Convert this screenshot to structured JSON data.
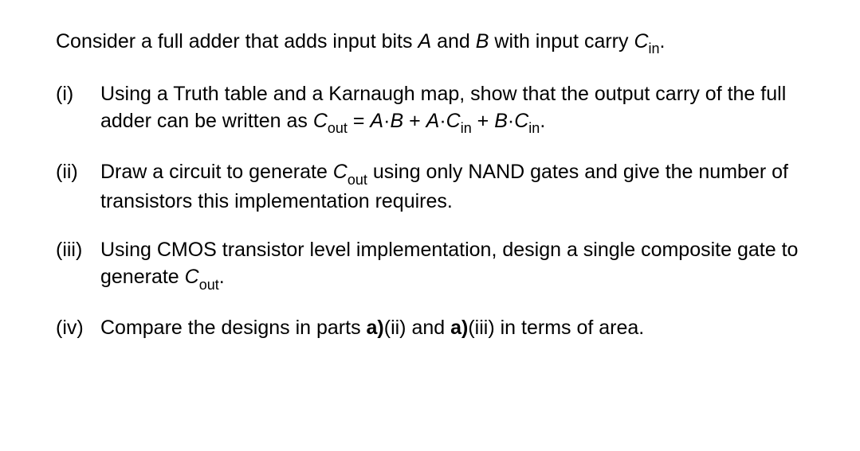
{
  "intro": {
    "pre": "Consider a full adder that adds input bits ",
    "A": "A",
    "mid1": " and ",
    "B": "B",
    "mid2": " with input carry ",
    "C": "C",
    "in": "in",
    "period": "."
  },
  "items": [
    {
      "marker": "(i)",
      "body": {
        "t1": "Using a Truth table and a Karnaugh map, show that the output carry of the full adder can be written as ",
        "C1": "C",
        "out1": "out",
        "eq1": " = ",
        "A1": "A",
        "dot1": "·",
        "B1": "B",
        "plus1": " + ",
        "A2": "A",
        "dot2": "·",
        "C2": "C",
        "in1": "in",
        "plus2": " + ",
        "B2": "B",
        "dot3": "·",
        "C3": "C",
        "in2": "in",
        "period": "."
      }
    },
    {
      "marker": "(ii)",
      "body": {
        "t1": "Draw a circuit to generate ",
        "C1": "C",
        "out1": "out",
        "t2": " using only NAND gates and give the number of transistors this implementation requires."
      }
    },
    {
      "marker": "(iii)",
      "body": {
        "t1": "Using CMOS transistor level implementation, design a single composite gate to generate ",
        "C1": "C",
        "out1": "out",
        "period": "."
      }
    },
    {
      "marker": "(iv)",
      "body": {
        "t1": "Compare the designs in parts ",
        "b1": "a)",
        "t2": "(ii) and ",
        "b2": "a)",
        "t3": "(iii) in terms of area."
      }
    }
  ]
}
